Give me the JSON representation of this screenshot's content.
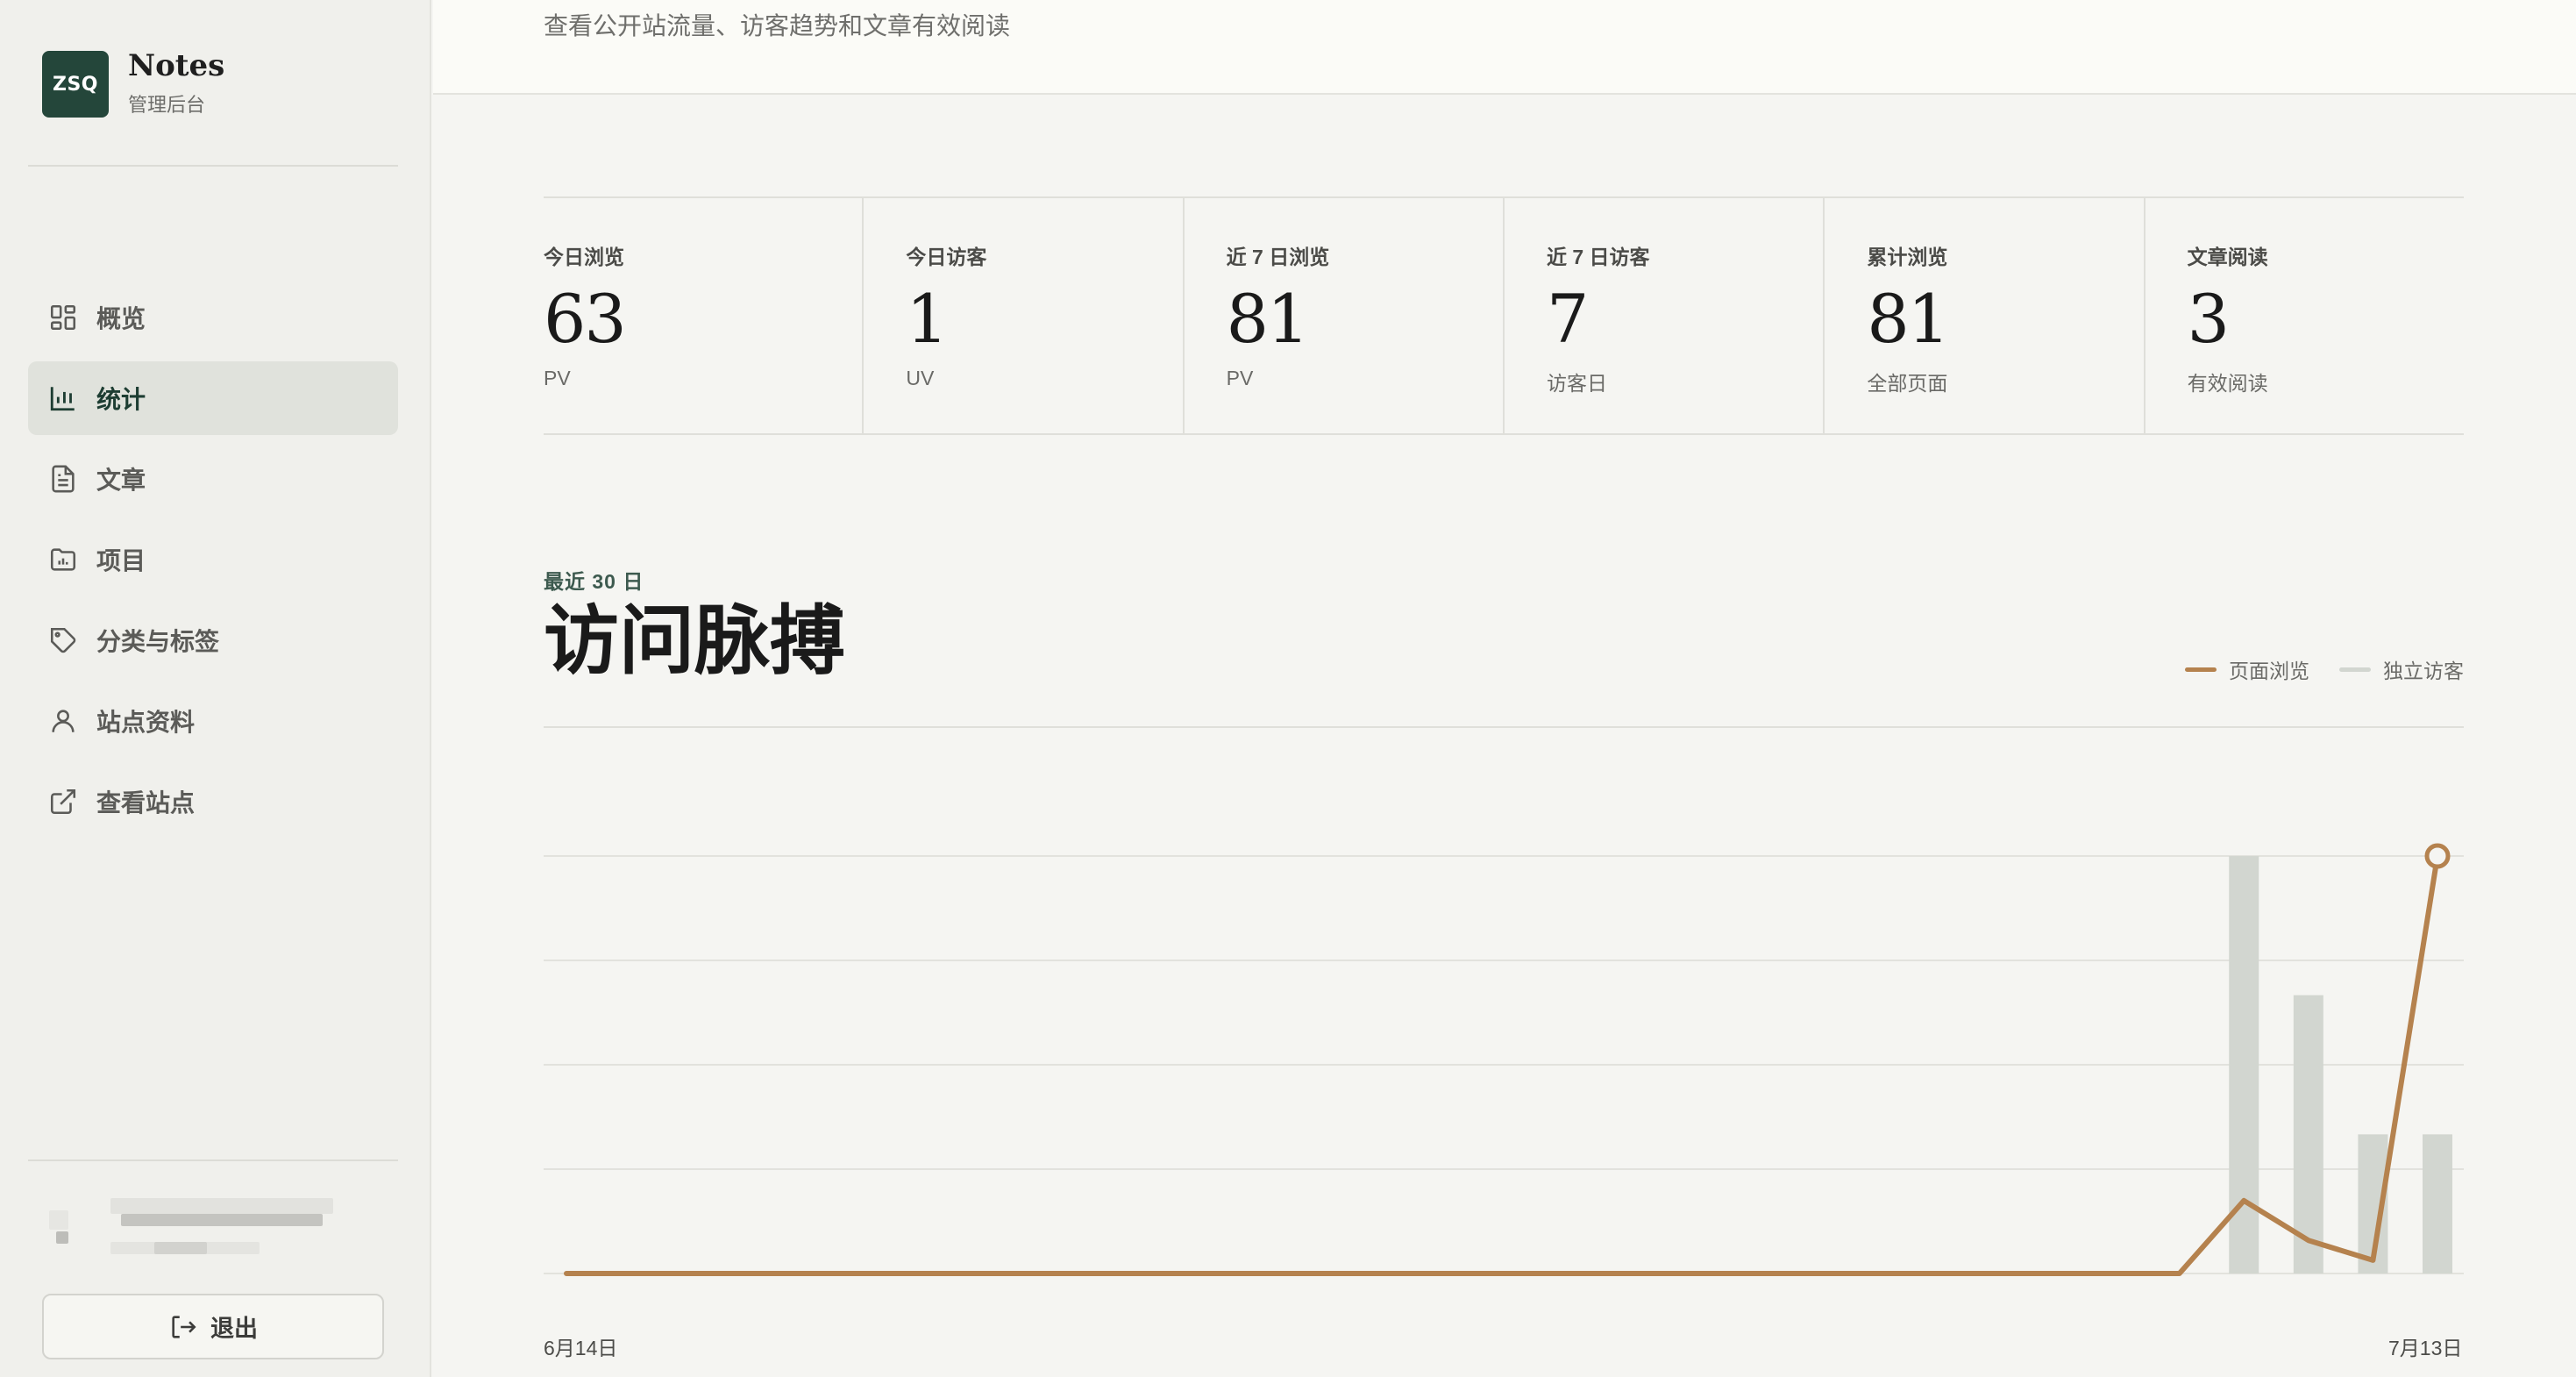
{
  "brand": {
    "logo_text": "ZSQ",
    "name": "Notes",
    "subtitle": "管理后台"
  },
  "nav": [
    {
      "label": "概览",
      "icon": "grid-icon",
      "active": false
    },
    {
      "label": "统计",
      "icon": "bar-chart-icon",
      "active": true
    },
    {
      "label": "文章",
      "icon": "document-icon",
      "active": false
    },
    {
      "label": "项目",
      "icon": "folder-icon",
      "active": false
    },
    {
      "label": "分类与标签",
      "icon": "tag-icon",
      "active": false
    },
    {
      "label": "站点资料",
      "icon": "user-icon",
      "active": false
    },
    {
      "label": "查看站点",
      "icon": "external-link-icon",
      "active": false
    }
  ],
  "logout_label": "退出",
  "header": {
    "subtitle": "查看公开站流量、访客趋势和文章有效阅读"
  },
  "stats": [
    {
      "label": "今日浏览",
      "value": "63",
      "unit": "PV"
    },
    {
      "label": "今日访客",
      "value": "1",
      "unit": "UV"
    },
    {
      "label": "近 7 日浏览",
      "value": "81",
      "unit": "PV"
    },
    {
      "label": "近 7 日访客",
      "value": "7",
      "unit": "访客日"
    },
    {
      "label": "累计浏览",
      "value": "81",
      "unit": "全部页面"
    },
    {
      "label": "文章阅读",
      "value": "3",
      "unit": "有效阅读"
    }
  ],
  "chart": {
    "eyebrow": "最近 30 日",
    "title": "访问脉搏",
    "legend": [
      {
        "name": "页面浏览",
        "color": "#b5824e"
      },
      {
        "name": "独立访客",
        "color": "#d2d6d0"
      }
    ],
    "x_start_label": "6月14日",
    "x_end_label": "7月13日"
  },
  "chart_data": {
    "type": "line",
    "x": [
      "6月14日",
      "6月15日",
      "6月16日",
      "6月17日",
      "6月18日",
      "6月19日",
      "6月20日",
      "6月21日",
      "6月22日",
      "6月23日",
      "6月24日",
      "6月25日",
      "6月26日",
      "6月27日",
      "6月28日",
      "6月29日",
      "6月30日",
      "7月1日",
      "7月2日",
      "7月3日",
      "7月4日",
      "7月5日",
      "7月6日",
      "7月7日",
      "7月8日",
      "7月9日",
      "7月10日",
      "7月11日",
      "7月12日",
      "7月13日"
    ],
    "series": [
      {
        "name": "页面浏览",
        "kind": "line",
        "color": "#b5824e",
        "values": [
          0,
          0,
          0,
          0,
          0,
          0,
          0,
          0,
          0,
          0,
          0,
          0,
          0,
          0,
          0,
          0,
          0,
          0,
          0,
          0,
          0,
          0,
          0,
          0,
          0,
          0,
          11,
          5,
          2,
          63
        ]
      },
      {
        "name": "独立访客",
        "kind": "bar",
        "color": "#d2d6d0",
        "values": [
          0,
          0,
          0,
          0,
          0,
          0,
          0,
          0,
          0,
          0,
          0,
          0,
          0,
          0,
          0,
          0,
          0,
          0,
          0,
          0,
          0,
          0,
          0,
          0,
          0,
          0,
          3,
          2,
          1,
          1
        ]
      }
    ],
    "grid": true,
    "legend_position": "top-right"
  }
}
